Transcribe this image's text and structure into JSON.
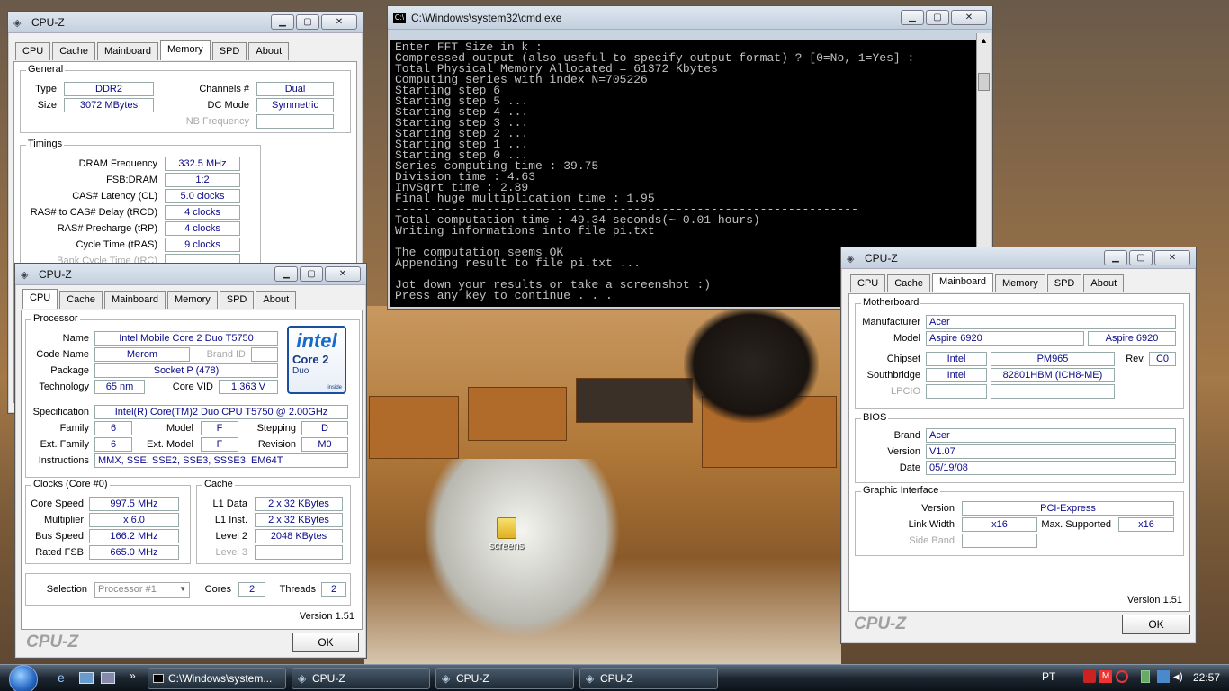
{
  "cpuz_memory": {
    "title": "CPU-Z",
    "tabs": [
      "CPU",
      "Cache",
      "Mainboard",
      "Memory",
      "SPD",
      "About"
    ],
    "active": "Memory",
    "general": {
      "title": "General",
      "type_l": "Type",
      "type": "DDR2",
      "size_l": "Size",
      "size": "3072 MBytes",
      "ch_l": "Channels #",
      "ch": "Dual",
      "dc_l": "DC Mode",
      "dc": "Symmetric",
      "nb_l": "NB Frequency"
    },
    "timings": {
      "title": "Timings",
      "dram_l": "DRAM Frequency",
      "dram": "332.5 MHz",
      "fsb_l": "FSB:DRAM",
      "fsb": "1:2",
      "cas_l": "CAS# Latency (CL)",
      "cas": "5.0 clocks",
      "rcd_l": "RAS# to CAS# Delay (tRCD)",
      "rcd": "4 clocks",
      "rp_l": "RAS# Precharge (tRP)",
      "rp": "4 clocks",
      "ras_l": "Cycle Time (tRAS)",
      "ras": "9 clocks",
      "rc_l": "Bank Cycle Time (tRC)"
    }
  },
  "cpuz_cpu": {
    "title": "CPU-Z",
    "tabs": [
      "CPU",
      "Cache",
      "Mainboard",
      "Memory",
      "SPD",
      "About"
    ],
    "active": "CPU",
    "proc": {
      "title": "Processor",
      "name_l": "Name",
      "name": "Intel Mobile Core 2 Duo T5750",
      "code_l": "Code Name",
      "code": "Merom",
      "brand_l": "Brand ID",
      "pkg_l": "Package",
      "pkg": "Socket P (478)",
      "tech_l": "Technology",
      "tech": "65 nm",
      "vid_l": "Core VID",
      "vid": "1.363 V",
      "spec_l": "Specification",
      "spec": "Intel(R) Core(TM)2 Duo CPU    T5750  @ 2.00GHz",
      "fam_l": "Family",
      "fam": "6",
      "model_l": "Model",
      "model": "F",
      "step_l": "Stepping",
      "step": "D",
      "efam_l": "Ext. Family",
      "efam": "6",
      "emodel_l": "Ext. Model",
      "emodel": "F",
      "rev_l": "Revision",
      "rev": "M0",
      "instr_l": "Instructions",
      "instr": "MMX, SSE, SSE2, SSE3, SSSE3, EM64T"
    },
    "logo": {
      "intel": "intel",
      "core": "Core 2",
      "duo": "Duo",
      "inside": "inside"
    },
    "clocks": {
      "title": "Clocks (Core #0)",
      "cs_l": "Core Speed",
      "cs": "997.5 MHz",
      "mul_l": "Multiplier",
      "mul": "x 6.0",
      "bus_l": "Bus Speed",
      "bus": "166.2 MHz",
      "fsb_l": "Rated FSB",
      "fsb": "665.0 MHz"
    },
    "cache": {
      "title": "Cache",
      "l1d_l": "L1 Data",
      "l1d": "2 x 32 KBytes",
      "l1i_l": "L1 Inst.",
      "l1i": "2 x 32 KBytes",
      "l2_l": "Level 2",
      "l2": "2048 KBytes",
      "l3_l": "Level 3"
    },
    "sel_l": "Selection",
    "sel": "Processor #1",
    "cores_l": "Cores",
    "cores": "2",
    "threads_l": "Threads",
    "threads": "2",
    "version": "Version 1.51",
    "brand": "CPU-Z",
    "ok": "OK"
  },
  "cmd": {
    "title": "C:\\Windows\\system32\\cmd.exe",
    "lines": [
      "Enter FFT Size in k :",
      "Compressed output (also useful to specify output format) ? [0=No, 1=Yes] :",
      "Total Physical Memory Allocated = 61372 Kbytes",
      "Computing series with index N=705226",
      "Starting step 6",
      "Starting step 5 ...",
      "Starting step 4 ...",
      "Starting step 3 ...",
      "Starting step 2 ...",
      "Starting step 1 ...",
      "Starting step 0 ...",
      "Series computing time : 39.75",
      "Division time : 4.63",
      "InvSqrt time : 2.89",
      "Final huge multiplication time : 1.95",
      "------------------------------------------------------------------",
      "Total computation time : 49.34 seconds(~ 0.01 hours)",
      "Writing informations into file pi.txt",
      "",
      "The computation seems OK",
      "Appending result to file pi.txt ...",
      "",
      "Jot down your results or take a screenshot :)",
      "Press any key to continue . . ."
    ]
  },
  "cpuz_mb": {
    "title": "CPU-Z",
    "tabs": [
      "CPU",
      "Cache",
      "Mainboard",
      "Memory",
      "SPD",
      "About"
    ],
    "active": "Mainboard",
    "mb": {
      "title": "Motherboard",
      "man_l": "Manufacturer",
      "man": "Acer",
      "model_l": "Model",
      "model": "Aspire 6920",
      "model2": "Aspire 6920",
      "chip_l": "Chipset",
      "chip_v": "Intel",
      "chip": "PM965",
      "rev_l": "Rev.",
      "rev": "C0",
      "sb_l": "Southbridge",
      "sb_v": "Intel",
      "sb": "82801HBM (ICH8-ME)",
      "lpc_l": "LPCIO"
    },
    "bios": {
      "title": "BIOS",
      "brand_l": "Brand",
      "brand": "Acer",
      "ver_l": "Version",
      "ver": "V1.07",
      "date_l": "Date",
      "date": "05/19/08"
    },
    "gi": {
      "title": "Graphic Interface",
      "ver_l": "Version",
      "ver": "PCI-Express",
      "lw_l": "Link Width",
      "lw": "x16",
      "max_l": "Max. Supported",
      "max": "x16",
      "sb_l": "Side Band"
    },
    "version": "Version 1.51",
    "brand": "CPU-Z",
    "ok": "OK"
  },
  "desktop": {
    "folder": "screens"
  },
  "taskbar": {
    "items": [
      "C:\\Windows\\system...",
      "CPU-Z",
      "CPU-Z",
      "CPU-Z"
    ],
    "lang": "PT",
    "time": "22:57"
  }
}
